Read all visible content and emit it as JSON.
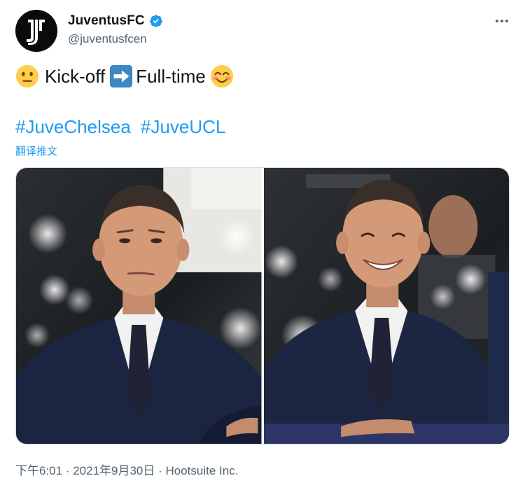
{
  "account": {
    "display_name": "JuventusFC",
    "handle": "@juventusfcen"
  },
  "icons": {
    "avatar": "juventus-logo-icon",
    "verified": "verified-badge-icon",
    "more": "more-options-icon",
    "emoji_1": "neutral-face-emoji-icon",
    "emoji_2": "right-arrow-emoji-icon",
    "emoji_3": "smiling-face-emoji-icon"
  },
  "tweet": {
    "text_part_1": "Kick-off",
    "text_part_2": "Full-time",
    "hashtag_1": "#JuveChelsea",
    "hashtag_2": "#JuveUCL",
    "translate_label": "翻译推文"
  },
  "footer": {
    "time": "下午6:01",
    "separator_1": " · ",
    "date": "2021年9月30日",
    "separator_2": " · ",
    "source": "Hootsuite Inc."
  },
  "colors": {
    "link": "#1d9bf0",
    "secondary_text": "#536471",
    "primary_text": "#0f1419",
    "verified": "#1d9bf0"
  }
}
